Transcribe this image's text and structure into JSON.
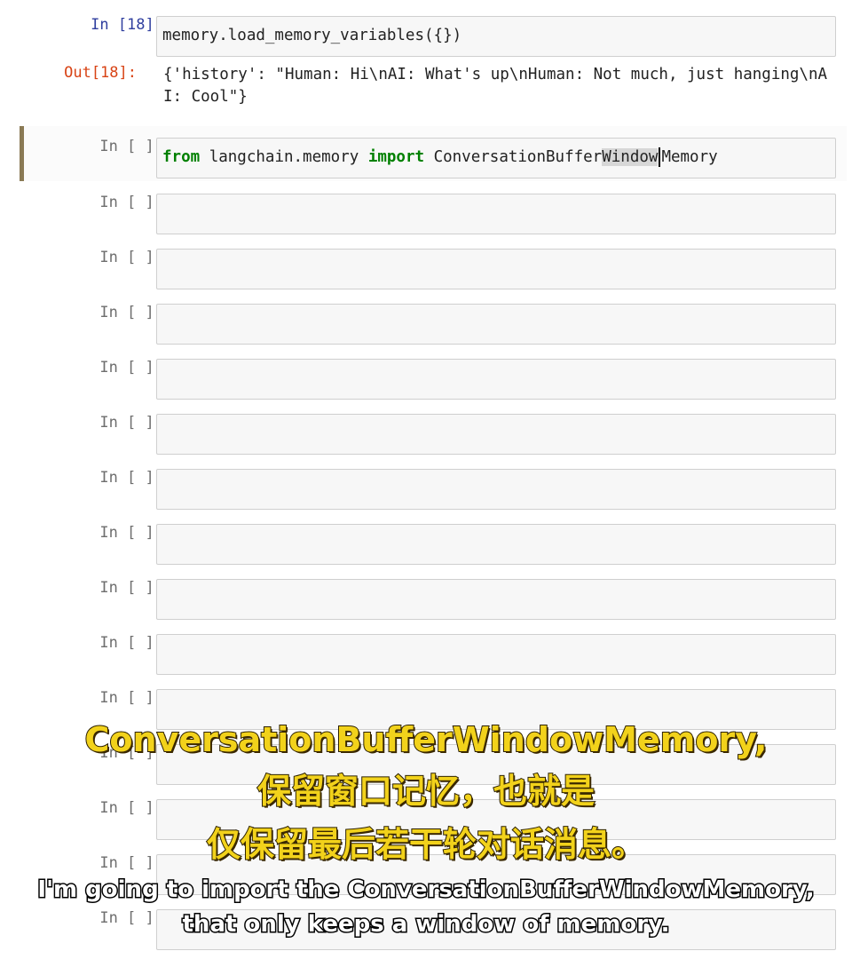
{
  "cells": [
    {
      "prompt": "In [18]:",
      "code": "memory.load_memory_variables({})"
    },
    {
      "prompt": "Out[18]:",
      "output": "{'history': \"Human: Hi\\nAI: What's up\\nHuman: Not much, just hanging\\nAI: Cool\"}"
    },
    {
      "prompt": "In [ ]:",
      "code_kw1": "from",
      "code_mid": " langchain.memory ",
      "code_kw2": "import",
      "code_pre": " ConversationBuffer",
      "code_sel": "Window",
      "code_post": "Memory"
    }
  ],
  "empty_prompt": "In [ ]:",
  "subtitles": {
    "cn_line1": "ConversationBufferWindowMemory,",
    "cn_line2": "保留窗口记忆，也就是",
    "cn_line3": "仅保留最后若干轮对话消息。",
    "en_line1": "I'm going to import the ConversationBufferWindowMemory,",
    "en_line2": "that only keeps a window of memory."
  },
  "colors": {
    "prompt_in": "#303f9f",
    "prompt_out": "#d84315",
    "keyword": "#008000",
    "subtitle_cn": "#f2d21b",
    "subtitle_en": "#ffffff"
  }
}
